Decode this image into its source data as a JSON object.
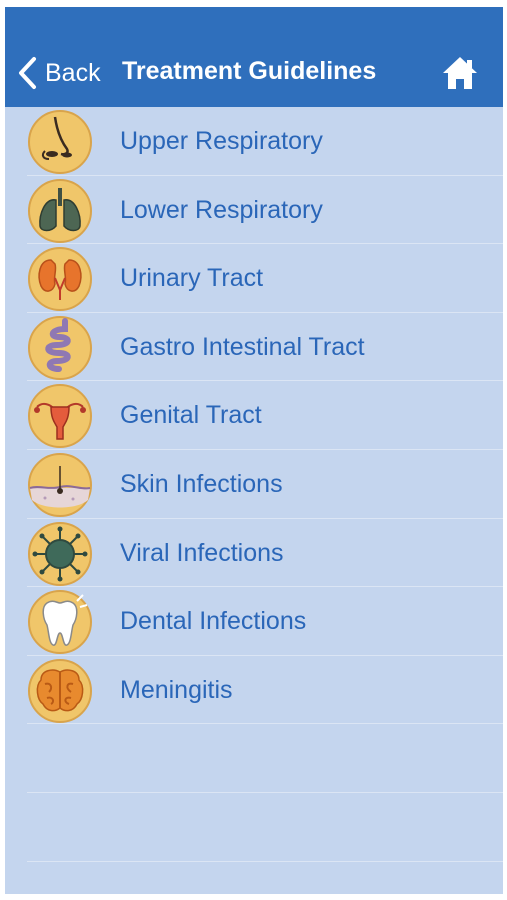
{
  "navbar": {
    "back_label": "Back",
    "title": "Treatment Guidelines",
    "home_icon": "home-icon",
    "background": "#2f6fbc"
  },
  "list": {
    "items": [
      {
        "label": "Upper Respiratory",
        "icon": "nose-icon"
      },
      {
        "label": "Lower Respiratory",
        "icon": "lungs-icon"
      },
      {
        "label": "Urinary Tract",
        "icon": "kidneys-icon"
      },
      {
        "label": "Gastro Intestinal Tract",
        "icon": "intestine-icon"
      },
      {
        "label": "Genital Tract",
        "icon": "uterus-icon"
      },
      {
        "label": "Skin Infections",
        "icon": "skin-icon"
      },
      {
        "label": "Viral Infections",
        "icon": "virus-icon"
      },
      {
        "label": "Dental Infections",
        "icon": "tooth-icon"
      },
      {
        "label": "Meningitis",
        "icon": "brain-icon"
      }
    ]
  },
  "colors": {
    "background": "#c4d5ee",
    "label": "#2a66b8",
    "icon_fill": "#f0c66a",
    "icon_ring": "#d9a44b"
  }
}
